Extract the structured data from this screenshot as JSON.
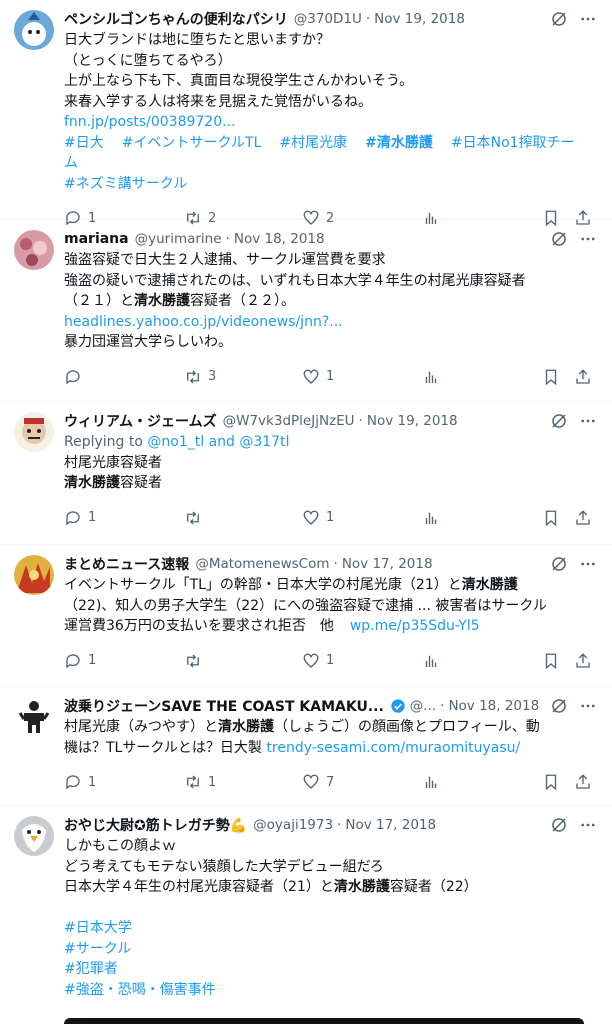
{
  "tweets": [
    {
      "name": "ペンシルゴンちゃんの便利なパシリ",
      "handle": "@370D1U",
      "date": "Nov 19, 2018",
      "lines": [
        "日大ブランドは地に堕ちたと思いますか？",
        "（とっくに堕ちてるやろ）",
        "上が上なら下も下、真面目な現役学生さんかわいそう。",
        "来春入学する人は将来を見据えた覚悟がいるね。"
      ],
      "link": "fnn.jp/posts/00389720...",
      "tags": [
        "#日大",
        "#イベントサークルTL",
        "#村尾光康",
        "#清水勝護",
        "#日本No1搾取チーム",
        "#ネズミ講サークル"
      ],
      "replies": "1",
      "retweets": "2",
      "likes": "2",
      "views": "",
      "avatar_color": "#6aa8d8"
    },
    {
      "name": "mariana",
      "handle": "@yurimarine",
      "date": "Nov 18, 2018",
      "line1": "強盗容疑で日大生２人逮捕、サークル運営費を要求",
      "line2": "強盗の疑いで逮捕されたのは、いずれも日本大学４年生の村尾光康容疑者",
      "line3a": "（２１）と",
      "line3b": "清水勝護",
      "line3c": "容疑者（２２）。",
      "link": "headlines.yahoo.co.jp/videonews/jnn?...",
      "line4": "暴力団運営大学らしいわ。",
      "replies": "",
      "retweets": "3",
      "likes": "1",
      "views": "",
      "avatar_color": "#d99aa8"
    },
    {
      "name": "ウィリアム・ジェームズ",
      "handle": "@W7vk3dPleJjNzEU",
      "date": "Nov 19, 2018",
      "replying_prefix": "Replying to ",
      "replying_to": "@no1_tl and @317tl",
      "line1": "村尾光康容疑者",
      "line2a": "清水勝護",
      "line2b": "容疑者",
      "replies": "1",
      "retweets": "",
      "likes": "1",
      "views": "",
      "avatar_color": "#e8d6c0"
    },
    {
      "name": "まとめニュース速報",
      "handle": "@MatomenewsCom",
      "date": "Nov 17, 2018",
      "line1a": "イベントサークル「TL」の幹部・日本大学の村尾光康（21）と",
      "line1b": "清水勝護",
      "line2": "（22)、知人の男子大学生（22）にへの強盗容疑で逮捕 ... 被害者はサークル",
      "line3": "運営費36万円の支払いを要求され拒否　他",
      "link": "wp.me/p35Sdu-Yl5",
      "replies": "1",
      "retweets": "",
      "likes": "1",
      "views": "",
      "avatar_color": "#e0b040"
    },
    {
      "name": "波乗りジェーンSAVE THE COAST KAMAKU...",
      "handle": "@...",
      "date": "Nov 18, 2018",
      "line1a": "村尾光康（みつやす）と",
      "line1b": "清水勝護",
      "line1c": "（しょうご）の顔画像とプロフィール、動",
      "line2": "機は？TLサークルとは？日大製 ",
      "link": "trendy-sesami.com/muraomituyasu/",
      "replies": "1",
      "retweets": "1",
      "likes": "7",
      "views": "",
      "avatar_color": "#222222"
    },
    {
      "name": "おやじ大尉✪筋トレガチ勢💪",
      "handle": "@oyaji1973",
      "date": "Nov 17, 2018",
      "line1": "しかもこの顔よｗ",
      "line2": "どう考えてもモテない猿顔した大学デビュー組だろ",
      "line3a": "日本大学４年生の村尾光康容疑者（21）と",
      "line3b": "清水勝護",
      "line3c": "容疑者（22）",
      "tags": [
        "#日本大学",
        "#サークル",
        "#犯罪者",
        "#強盗・恐喝・傷害事件"
      ],
      "avatar_color": "#c8ccd0"
    }
  ],
  "colors": {
    "accent": "#1d9bf0",
    "muted": "#536471",
    "verified": "#1d9bf0"
  },
  "icons": [
    "reply-icon",
    "retweet-icon",
    "like-icon",
    "views-icon",
    "bookmark-icon",
    "share-icon",
    "grok-icon",
    "more-icon"
  ]
}
